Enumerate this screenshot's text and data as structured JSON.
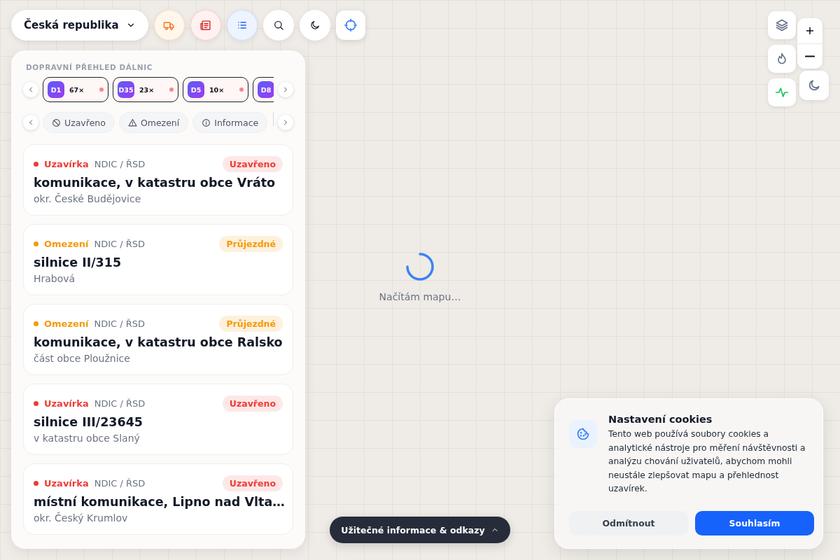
{
  "region_selector": {
    "label": "Česká republika"
  },
  "map": {
    "loading_text": "Načítám mapu…"
  },
  "panel": {
    "title": "DOPRAVNÍ PŘEHLED DÁLNIC",
    "highways": [
      {
        "code": "D1",
        "count": "67×"
      },
      {
        "code": "D35",
        "count": "23×"
      },
      {
        "code": "D5",
        "count": "10×"
      },
      {
        "code": "D8"
      }
    ],
    "filters": [
      {
        "kind": "closed",
        "label": "Uzavřeno"
      },
      {
        "kind": "restricted",
        "label": "Omezení"
      },
      {
        "kind": "info",
        "label": "Informace"
      }
    ],
    "events": [
      {
        "kind": "closure",
        "type": "Uzavírka",
        "source": "NDIC / ŘSD",
        "status": "Uzavřeno",
        "title": "komunikace, v katastru obce Vráto",
        "place": "okr. České Budějovice"
      },
      {
        "kind": "restriction",
        "type": "Omezení",
        "source": "NDIC / ŘSD",
        "status": "Průjezdné",
        "title": "silnice II/315",
        "place": "Hrabová"
      },
      {
        "kind": "restriction",
        "type": "Omezení",
        "source": "NDIC / ŘSD",
        "status": "Průjezdné",
        "title": "komunikace, v katastru obce Ralsko",
        "place": "část obce Ploužnice"
      },
      {
        "kind": "closure",
        "type": "Uzavírka",
        "source": "NDIC / ŘSD",
        "status": "Uzavřeno",
        "title": "silnice III/23645",
        "place": "v katastru obce Slaný"
      },
      {
        "kind": "closure",
        "type": "Uzavírka",
        "source": "NDIC / ŘSD",
        "status": "Uzavřeno",
        "title": "místní komunikace, Lipno nad Vlta…",
        "place": "okr. Český Krumlov"
      }
    ]
  },
  "info_button": {
    "label": "Užitečné informace & odkazy"
  },
  "cookie_banner": {
    "title": "Nastavení cookies",
    "text": "Tento web používá soubory cookies a analytické nástroje pro měření návštěvnosti a analýzu chování uživatelů, abychom mohli neustále zlepšovat mapu a přehlednost uzavírek.",
    "decline": "Odmítnout",
    "accept": "Souhlasím"
  }
}
